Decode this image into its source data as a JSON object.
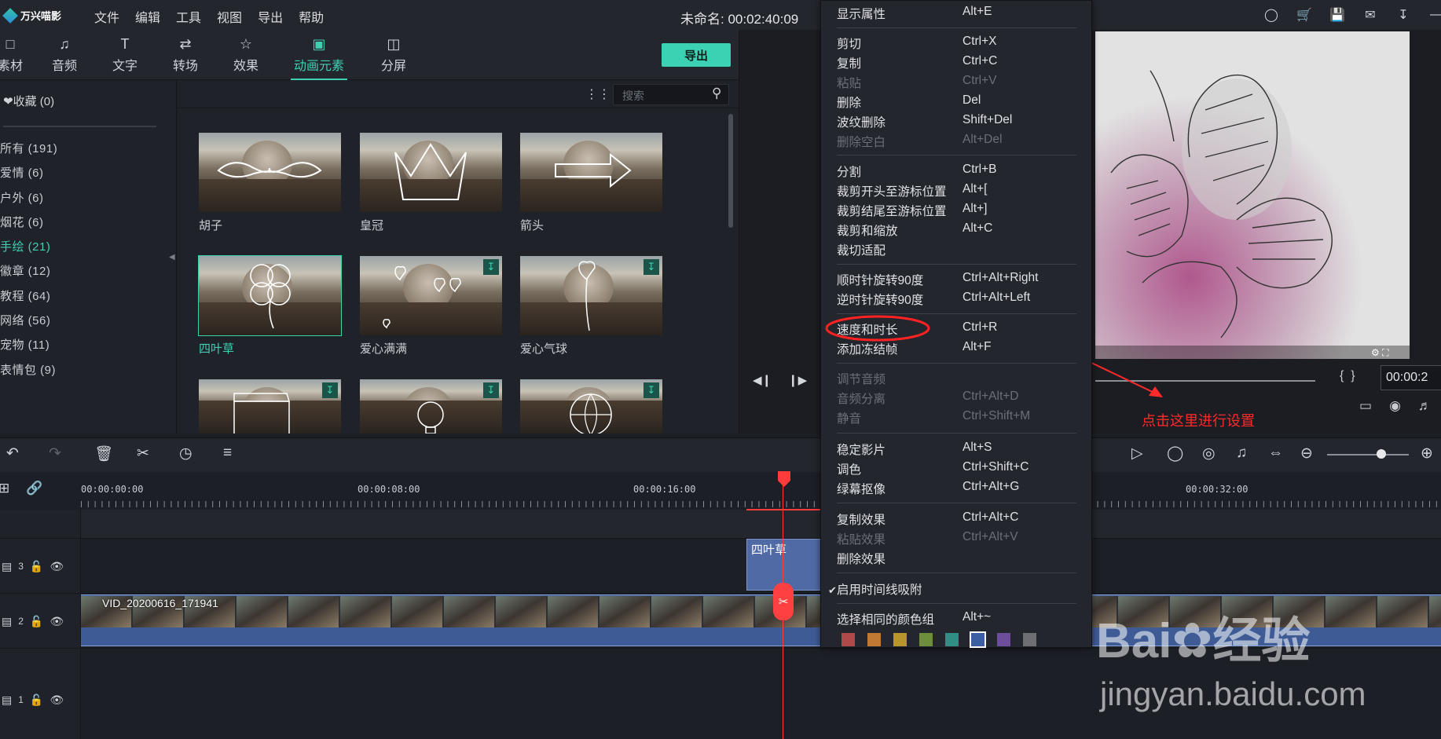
{
  "app": {
    "logo_text": "万兴喵影",
    "project_title": "未命名: 00:02:40:09"
  },
  "menubar": [
    "文件",
    "编辑",
    "工具",
    "视图",
    "导出",
    "帮助"
  ],
  "categories": [
    {
      "label": "素材",
      "icon": "folder-icon"
    },
    {
      "label": "音频",
      "icon": "music-icon"
    },
    {
      "label": "文字",
      "icon": "text-icon"
    },
    {
      "label": "转场",
      "icon": "transition-icon"
    },
    {
      "label": "效果",
      "icon": "effects-icon"
    },
    {
      "label": "动画元素",
      "icon": "image-icon",
      "active": true
    },
    {
      "label": "分屏",
      "icon": "split-screen-icon"
    }
  ],
  "export_button": "导出",
  "sidebar": {
    "favorites": "收藏 (0)",
    "items": [
      "所有 (191)",
      "爱情 (6)",
      "户外 (6)",
      "烟花 (6)",
      "手绘 (21)",
      "徽章 (12)",
      "教程 (64)",
      "网络 (56)",
      "宠物 (11)",
      "表情包 (9)"
    ],
    "active_index": 4
  },
  "search": {
    "placeholder": "搜索"
  },
  "thumbnails": [
    {
      "label": "胡子",
      "download": false
    },
    {
      "label": "皇冠",
      "download": false
    },
    {
      "label": "箭头",
      "download": false
    },
    {
      "label": "四叶草",
      "download": false,
      "selected": true
    },
    {
      "label": "爱心满满",
      "download": true
    },
    {
      "label": "爱心气球",
      "download": true
    },
    {
      "label": "",
      "download": true
    },
    {
      "label": "",
      "download": true
    },
    {
      "label": "",
      "download": true
    }
  ],
  "preview": {
    "timecode": "00:00:2"
  },
  "annotation": {
    "text": "点击这里进行设置"
  },
  "context_menu": {
    "items": [
      {
        "label": "显示属性",
        "shortcut": "Alt+E",
        "enabled": true
      },
      {
        "label": "剪切",
        "shortcut": "Ctrl+X",
        "enabled": true
      },
      {
        "label": "复制",
        "shortcut": "Ctrl+C",
        "enabled": true
      },
      {
        "label": "粘贴",
        "shortcut": "Ctrl+V",
        "enabled": false
      },
      {
        "label": "删除",
        "shortcut": "Del",
        "enabled": true
      },
      {
        "label": "波纹删除",
        "shortcut": "Shift+Del",
        "enabled": true
      },
      {
        "label": "删除空白",
        "shortcut": "Alt+Del",
        "enabled": false
      },
      {
        "label": "分割",
        "shortcut": "Ctrl+B",
        "enabled": true
      },
      {
        "label": "裁剪开头至游标位置",
        "shortcut": "Alt+[",
        "enabled": true
      },
      {
        "label": "裁剪结尾至游标位置",
        "shortcut": "Alt+]",
        "enabled": true
      },
      {
        "label": "裁剪和缩放",
        "shortcut": "Alt+C",
        "enabled": true
      },
      {
        "label": "裁切适配",
        "shortcut": "",
        "enabled": true
      },
      {
        "label": "顺时针旋转90度",
        "shortcut": "Ctrl+Alt+Right",
        "enabled": true
      },
      {
        "label": "逆时针旋转90度",
        "shortcut": "Ctrl+Alt+Left",
        "enabled": true
      },
      {
        "label": "速度和时长",
        "shortcut": "Ctrl+R",
        "enabled": true,
        "highlighted": true
      },
      {
        "label": "添加冻结帧",
        "shortcut": "Alt+F",
        "enabled": true
      },
      {
        "label": "调节音频",
        "shortcut": "",
        "enabled": false
      },
      {
        "label": "音频分离",
        "shortcut": "Ctrl+Alt+D",
        "enabled": false
      },
      {
        "label": "静音",
        "shortcut": "Ctrl+Shift+M",
        "enabled": false
      },
      {
        "label": "稳定影片",
        "shortcut": "Alt+S",
        "enabled": true
      },
      {
        "label": "调色",
        "shortcut": "Ctrl+Shift+C",
        "enabled": true
      },
      {
        "label": "绿幕抠像",
        "shortcut": "Ctrl+Alt+G",
        "enabled": true
      },
      {
        "label": "复制效果",
        "shortcut": "Ctrl+Alt+C",
        "enabled": true
      },
      {
        "label": "粘贴效果",
        "shortcut": "Ctrl+Alt+V",
        "enabled": false
      },
      {
        "label": "删除效果",
        "shortcut": "",
        "enabled": true
      },
      {
        "label": "启用时间线吸附",
        "shortcut": "",
        "enabled": true,
        "checked": true
      },
      {
        "label": "选择相同的颜色组",
        "shortcut": "Alt+~",
        "enabled": true
      }
    ],
    "color_swatches": [
      "#b04a4a",
      "#c07a34",
      "#b8962e",
      "#6e8f3a",
      "#2f8f85",
      "#3b5fa0",
      "#6c4e9b",
      "#6d6f73"
    ],
    "selected_swatch": 5
  },
  "timeline": {
    "ruler": [
      "00:00:00:00",
      "00:00:08:00",
      "00:00:16:00",
      "00:00:32:00"
    ],
    "tracks": [
      {
        "number": "3"
      },
      {
        "number": "2"
      },
      {
        "number": "1"
      }
    ],
    "title_clip": "四叶草",
    "video_clip": "VID_20200616_171941"
  },
  "watermark": {
    "brand": "Bai",
    "brand2": "经验",
    "url": "jingyan.baidu.com"
  }
}
